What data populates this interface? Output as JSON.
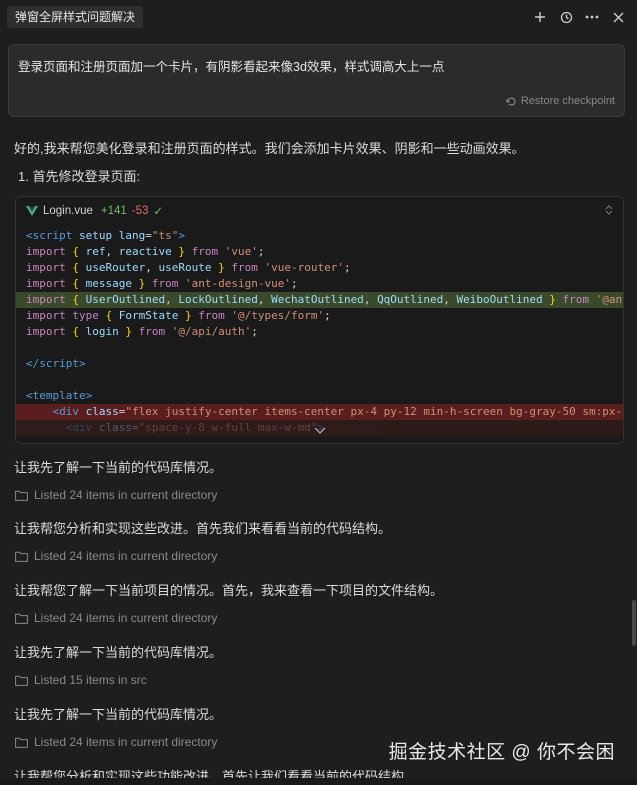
{
  "header": {
    "tab_title": "弹窗全屏样式问题解决",
    "icons": [
      "plus-icon",
      "history-icon",
      "more-icon",
      "close-icon"
    ]
  },
  "prompt": {
    "text": "登录页面和注册页面加一个卡片，有阴影看起来像3d效果，样式调高大上一点",
    "restore_label": "Restore checkpoint"
  },
  "messages": {
    "intro": "好的,我来帮您美化登录和注册页面的样式。我们会添加卡片效果、阴影和一些动画效果。",
    "step1": "1. 首先修改登录页面:",
    "m1": "让我先了解一下当前的代码库情况。",
    "m2": "让我帮您分析和实现这些改进。首先我们来看看当前的代码结构。",
    "m3": "让我帮您了解一下当前项目的情况。首先，我来查看一下项目的文件结构。",
    "m4": "让我先了解一下当前的代码库情况。",
    "m5": "让我先了解一下当前的代码库情况。",
    "m6": "让我帮您分析和实现这些功能改进。首先让我们看看当前的代码结构。"
  },
  "listed": {
    "l1": "Listed 24 items in current directory",
    "l2": "Listed 24 items in current directory",
    "l3": "Listed 24 items in current directory",
    "l4": "Listed 15 items in src",
    "l5": "Listed 24 items in current directory"
  },
  "code_card": {
    "filename": "Login.vue",
    "additions": "+141",
    "deletions": "-53"
  },
  "watermark": "掘金技术社区 @ 你不会困",
  "colors": {
    "background": "#1e1e1e",
    "added_line": "#3a4a2a",
    "deleted_line": "#5a1e1e",
    "additions": "#6fbf73",
    "deletions": "#e06c6c"
  }
}
